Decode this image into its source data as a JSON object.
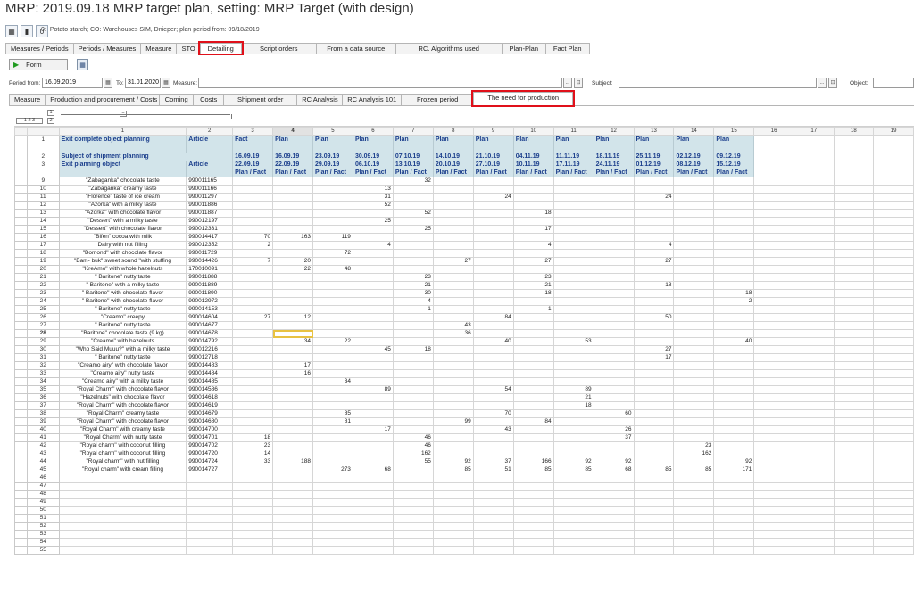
{
  "title": "MRP: 2019.09.18 MRP target plan, setting: MRP Target (with design)",
  "toolbar": {
    "count": "0",
    "info": "Potato starch; CO: Warehouses SIM, Dnieper; plan period from: 09/18/2019",
    "zero_label": "0:"
  },
  "tabs_top": [
    {
      "label": "Measures / Periods"
    },
    {
      "label": "Periods / Measures"
    },
    {
      "label": "Measure"
    },
    {
      "label": "STO"
    },
    {
      "label": "Detailing"
    },
    {
      "label": "Script orders"
    },
    {
      "label": "From a data source"
    },
    {
      "label": "RC. Algorithms used"
    },
    {
      "label": "Plan-Plan"
    },
    {
      "label": "Fact Plan"
    }
  ],
  "form_button": "Form",
  "filters": {
    "period_from_label": "Period from:",
    "period_from": "16.09.2019",
    "to_label": "To:",
    "to": "31.01.2020",
    "measure_label": "Measure:",
    "subject_label": "Subject:",
    "object_label": "Object:",
    "dots": "...",
    "clear_icon": "⊡"
  },
  "tabs_bottom": [
    {
      "label": "Measure"
    },
    {
      "label": "Production and procurement / Costs"
    },
    {
      "label": "Coming"
    },
    {
      "label": "Costs"
    },
    {
      "label": "Shipment order"
    },
    {
      "label": "RC Analysis"
    },
    {
      "label": "RC Analysis 101"
    },
    {
      "label": "Frozen period"
    },
    {
      "label": "The need for production"
    }
  ],
  "outline": {
    "level1": "1",
    "level2": "2",
    "levels": "1 2 3",
    "minus": "−"
  },
  "col_numbers": [
    "1",
    "2",
    "3",
    "4",
    "5",
    "6",
    "7",
    "8",
    "9",
    "10",
    "11",
    "12",
    "13",
    "14",
    "15",
    "16",
    "17",
    "18",
    "19"
  ],
  "header_rows": {
    "r1": {
      "num": "1",
      "label": "Exit complete object planning",
      "article": "Article",
      "types": [
        "Fact",
        "Plan",
        "Plan",
        "Plan",
        "Plan",
        "Plan",
        "Plan",
        "Plan",
        "Plan",
        "Plan",
        "Plan",
        "Plan",
        "Plan"
      ]
    },
    "r2": {
      "num": "2",
      "label": "Subject of shipment planning",
      "dates": [
        "16.09.19",
        "16.09.19",
        "23.09.19",
        "30.09.19",
        "07.10.19",
        "14.10.19",
        "21.10.19",
        "04.11.19",
        "11.11.19",
        "18.11.19",
        "25.11.19",
        "02.12.19",
        "09.12.19"
      ]
    },
    "r3": {
      "num": "3",
      "label": "Exit planning object",
      "article": "Article",
      "dates": [
        "22.09.19",
        "22.09.19",
        "29.09.19",
        "06.10.19",
        "13.10.19",
        "20.10.19",
        "27.10.19",
        "10.11.19",
        "17.11.19",
        "24.11.19",
        "01.12.19",
        "08.12.19",
        "15.12.19"
      ],
      "sub": "Plan / Fact"
    }
  },
  "rows": [
    {
      "n": "9",
      "name": "\"Zabaganka\" chocolate taste",
      "article": "990011165",
      "v": [
        "",
        "",
        "",
        "",
        "32",
        "",
        "",
        "",
        "",
        "",
        "",
        "",
        ""
      ]
    },
    {
      "n": "10",
      "name": "\"Zabaganka\" creamy taste",
      "article": "990011166",
      "v": [
        "",
        "",
        "",
        "13",
        "",
        "",
        "",
        "",
        "",
        "",
        "",
        "",
        ""
      ]
    },
    {
      "n": "11",
      "name": "\"Florence\" taste of ice cream",
      "article": "990011297",
      "v": [
        "",
        "",
        "",
        "31",
        "",
        "",
        "24",
        "",
        "",
        "",
        "24",
        "",
        ""
      ]
    },
    {
      "n": "12",
      "name": "\"Azorka\" with a milky taste",
      "article": "990011886",
      "v": [
        "",
        "",
        "",
        "52",
        "",
        "",
        "",
        "",
        "",
        "",
        "",
        "",
        ""
      ]
    },
    {
      "n": "13",
      "name": "\"Azorka\" with chocolate flavor",
      "article": "990011887",
      "v": [
        "",
        "",
        "",
        "",
        "52",
        "",
        "",
        "18",
        "",
        "",
        "",
        "",
        ""
      ]
    },
    {
      "n": "14",
      "name": "\"Dessert\" with a milky taste",
      "article": "990012197",
      "v": [
        "",
        "",
        "",
        "25",
        "",
        "",
        "",
        "",
        "",
        "",
        "",
        "",
        ""
      ]
    },
    {
      "n": "15",
      "name": "\"Dessert\" with chocolate flavor",
      "article": "990012331",
      "v": [
        "",
        "",
        "",
        "",
        "25",
        "",
        "",
        "17",
        "",
        "",
        "",
        "",
        ""
      ]
    },
    {
      "n": "16",
      "name": "\"Bifen\" cocoa with milk",
      "article": "990014417",
      "v": [
        "70",
        "163",
        "119",
        "",
        "",
        "",
        "",
        "",
        "",
        "",
        "",
        "",
        ""
      ]
    },
    {
      "n": "17",
      "name": "Dairy with nut filling",
      "article": "990012352",
      "v": [
        "2",
        "",
        "",
        "4",
        "",
        "",
        "",
        "4",
        "",
        "",
        "4",
        "",
        ""
      ]
    },
    {
      "n": "18",
      "name": "\"Bomond\" with chocolate flavor",
      "article": "990011729",
      "v": [
        "",
        "",
        "72",
        "",
        "",
        "",
        "",
        "",
        "",
        "",
        "",
        "",
        ""
      ]
    },
    {
      "n": "19",
      "name": "\"Bam- buk\" sweet sound \"with stuffing",
      "article": "990014426",
      "v": [
        "7",
        "20",
        "",
        "",
        "",
        "27",
        "",
        "27",
        "",
        "",
        "27",
        "",
        ""
      ]
    },
    {
      "n": "20",
      "name": "\"KreAmo\" with whole hazelnuts",
      "article": "170010091",
      "v": [
        "",
        "22",
        "48",
        "",
        "",
        "",
        "",
        "",
        "",
        "",
        "",
        "",
        ""
      ]
    },
    {
      "n": "21",
      "name": "\" Baritone\" nutty taste",
      "article": "990011888",
      "v": [
        "",
        "",
        "",
        "",
        "23",
        "",
        "",
        "23",
        "",
        "",
        "",
        "",
        ""
      ]
    },
    {
      "n": "22",
      "name": "\" Baritone\" with a milky taste",
      "article": "990011889",
      "v": [
        "",
        "",
        "",
        "",
        "21",
        "",
        "",
        "21",
        "",
        "",
        "18",
        "",
        ""
      ]
    },
    {
      "n": "23",
      "name": "\" Baritone\" with chocolate flavor",
      "article": "990011890",
      "v": [
        "",
        "",
        "",
        "",
        "30",
        "",
        "",
        "18",
        "",
        "",
        "",
        "",
        "18"
      ]
    },
    {
      "n": "24",
      "name": "\" Baritone\" with chocolate flavor",
      "article": "990012972",
      "v": [
        "",
        "",
        "",
        "",
        "4",
        "",
        "",
        "",
        "",
        "",
        "",
        "",
        "2"
      ]
    },
    {
      "n": "25",
      "name": "\" Baritone\" nutty taste",
      "article": "990014153",
      "v": [
        "",
        "",
        "",
        "",
        "1",
        "",
        "",
        "1",
        "",
        "",
        "",
        "",
        ""
      ]
    },
    {
      "n": "26",
      "name": "\"Creamo\" creepy",
      "article": "990014604",
      "v": [
        "27",
        "12",
        "",
        "",
        "",
        "",
        "84",
        "",
        "",
        "",
        "50",
        "",
        ""
      ]
    },
    {
      "n": "27",
      "name": "\" Baritone\" nutty taste",
      "article": "990014677",
      "v": [
        "",
        "",
        "",
        "",
        "",
        "43",
        "",
        "",
        "",
        "",
        "",
        "",
        ""
      ]
    },
    {
      "n": "28",
      "name": "\"Baritone\" chocolate taste (9 kg)",
      "article": "990014678",
      "v": [
        "",
        "",
        "",
        "",
        "",
        "36",
        "",
        "",
        "",
        "",
        "",
        "",
        ""
      ]
    },
    {
      "n": "29",
      "name": "\"Creamo\" with hazelnuts",
      "article": "990014792",
      "v": [
        "",
        "34",
        "22",
        "",
        "",
        "",
        "40",
        "",
        "53",
        "",
        "",
        "",
        "40"
      ]
    },
    {
      "n": "30",
      "name": "\"Who Said Muuu?\" with a milky taste",
      "article": "990012216",
      "v": [
        "",
        "",
        "",
        "45",
        "18",
        "",
        "",
        "",
        "",
        "",
        "27",
        "",
        ""
      ]
    },
    {
      "n": "31",
      "name": "\" Baritone\" nutty taste",
      "article": "990012718",
      "v": [
        "",
        "",
        "",
        "",
        "",
        "",
        "",
        "",
        "",
        "",
        "17",
        "",
        ""
      ]
    },
    {
      "n": "32",
      "name": "\"Creamo airy\" with chocolate flavor",
      "article": "990014483",
      "v": [
        "",
        "17",
        "",
        "",
        "",
        "",
        "",
        "",
        "",
        "",
        "",
        "",
        ""
      ]
    },
    {
      "n": "33",
      "name": "\"Creamo airy\" nutty taste",
      "article": "990014484",
      "v": [
        "",
        "16",
        "",
        "",
        "",
        "",
        "",
        "",
        "",
        "",
        "",
        "",
        ""
      ]
    },
    {
      "n": "34",
      "name": "\"Creamo airy\" with a milky taste",
      "article": "990014485",
      "v": [
        "",
        "",
        "34",
        "",
        "",
        "",
        "",
        "",
        "",
        "",
        "",
        "",
        ""
      ]
    },
    {
      "n": "35",
      "name": "\"Royal Charm\" with chocolate flavor",
      "article": "990014586",
      "v": [
        "",
        "",
        "",
        "89",
        "",
        "",
        "54",
        "",
        "89",
        "",
        "",
        "",
        ""
      ]
    },
    {
      "n": "36",
      "name": "\"Hazelnuts\" with chocolate flavor",
      "article": "990014618",
      "v": [
        "",
        "",
        "",
        "",
        "",
        "",
        "",
        "",
        "21",
        "",
        "",
        "",
        ""
      ]
    },
    {
      "n": "37",
      "name": "\"Royal Charm\" with chocolate flavor",
      "article": "990014619",
      "v": [
        "",
        "",
        "",
        "",
        "",
        "",
        "",
        "",
        "18",
        "",
        "",
        "",
        ""
      ]
    },
    {
      "n": "38",
      "name": "\"Royal Charm\" creamy taste",
      "article": "990014679",
      "v": [
        "",
        "",
        "85",
        "",
        "",
        "",
        "70",
        "",
        "",
        "60",
        "",
        "",
        ""
      ]
    },
    {
      "n": "39",
      "name": "\"Royal Charm\" with chocolate flavor",
      "article": "990014680",
      "v": [
        "",
        "",
        "81",
        "",
        "",
        "99",
        "",
        "84",
        "",
        "",
        "",
        "",
        ""
      ]
    },
    {
      "n": "40",
      "name": "\"Royal Charm\" with creamy taste",
      "article": "990014700",
      "v": [
        "",
        "",
        "",
        "17",
        "",
        "",
        "43",
        "",
        "",
        "26",
        "",
        "",
        ""
      ]
    },
    {
      "n": "41",
      "name": "\"Royal Charm\" with nutty taste",
      "article": "990014701",
      "v": [
        "18",
        "",
        "",
        "",
        "46",
        "",
        "",
        "",
        "",
        "37",
        "",
        "",
        ""
      ]
    },
    {
      "n": "42",
      "name": "\"Royal charm\" with coconut filling",
      "article": "990014702",
      "v": [
        "23",
        "",
        "",
        "",
        "46",
        "",
        "",
        "",
        "",
        "",
        "",
        "23",
        ""
      ]
    },
    {
      "n": "43",
      "name": "\"Royal charm\" with coconut filling",
      "article": "990014720",
      "v": [
        "14",
        "",
        "",
        "",
        "162",
        "",
        "",
        "",
        "",
        "",
        "",
        "162",
        ""
      ]
    },
    {
      "n": "44",
      "name": "\"Royal charm\" with nut filling",
      "article": "990014724",
      "v": [
        "33",
        "188",
        "",
        "",
        "55",
        "92",
        "37",
        "166",
        "92",
        "92",
        "",
        "",
        "92"
      ]
    },
    {
      "n": "45",
      "name": "\"Royal charm\" with cream filling",
      "article": "990014727",
      "v": [
        "",
        "",
        "273",
        "68",
        "",
        "85",
        "51",
        "85",
        "85",
        "68",
        "85",
        "85",
        "171"
      ]
    }
  ],
  "empty_rows": [
    "46",
    "47",
    "48",
    "49",
    "50",
    "51",
    "52",
    "53",
    "54",
    "55"
  ],
  "active_row": "28"
}
